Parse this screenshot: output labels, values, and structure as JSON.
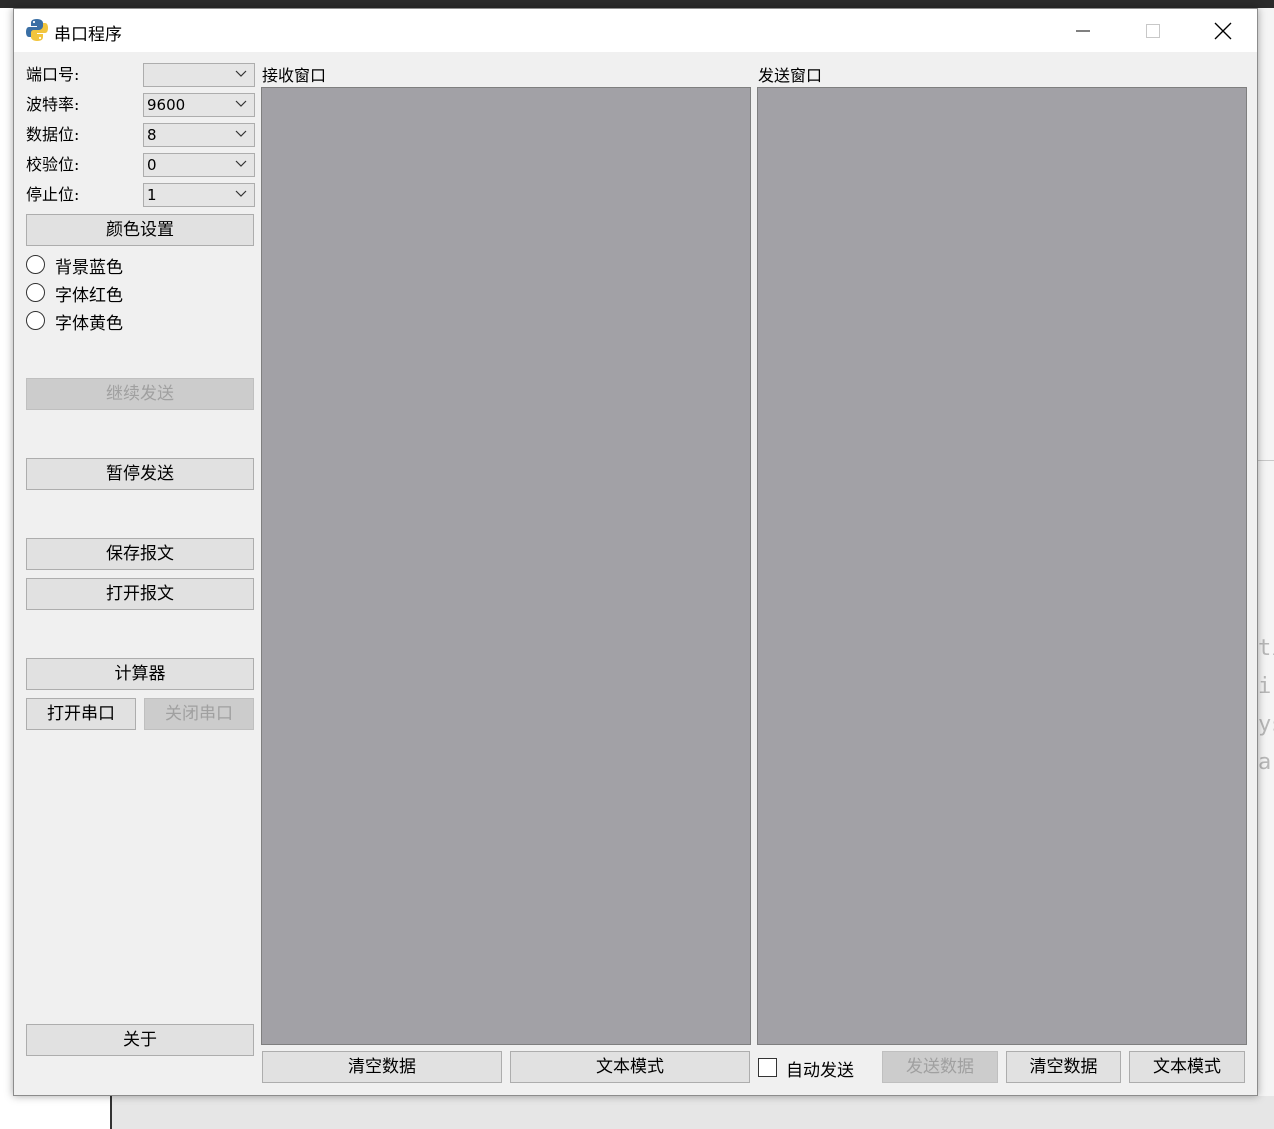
{
  "background": {
    "right_text_lines": [
      "ti",
      "ir",
      "ys",
      "a"
    ]
  },
  "window": {
    "title": "串口程序",
    "icon": "python-logo-icon",
    "controls": {
      "minimize": "minimize-icon",
      "maximize": "maximize-icon",
      "close": "close-icon"
    }
  },
  "settings": {
    "port": {
      "label": "端口号:",
      "value": ""
    },
    "baud": {
      "label": "波特率:",
      "value": "9600"
    },
    "databits": {
      "label": "数据位:",
      "value": "8"
    },
    "parity": {
      "label": "校验位:",
      "value": "0"
    },
    "stopbits": {
      "label": "停止位:",
      "value": "1"
    }
  },
  "color_settings": {
    "button": "颜色设置",
    "options": [
      "背景蓝色",
      "字体红色",
      "字体黄色"
    ]
  },
  "buttons": {
    "continue_send": "继续发送",
    "pause_send": "暂停发送",
    "save_message": "保存报文",
    "open_message": "打开报文",
    "calculator": "计算器",
    "open_port": "打开串口",
    "close_port": "关闭串口",
    "about": "关于"
  },
  "receive": {
    "title": "接收窗口",
    "clear": "清空数据",
    "mode": "文本模式"
  },
  "send": {
    "title": "发送窗口",
    "auto_send": "自动发送",
    "send": "发送数据",
    "clear": "清空数据",
    "mode": "文本模式"
  },
  "colors": {
    "pane_bg": "#a2a1a6",
    "window_bg": "#f0f0f0",
    "button_bg": "#e1e1e1",
    "disabled_text": "#a0a0a0"
  }
}
